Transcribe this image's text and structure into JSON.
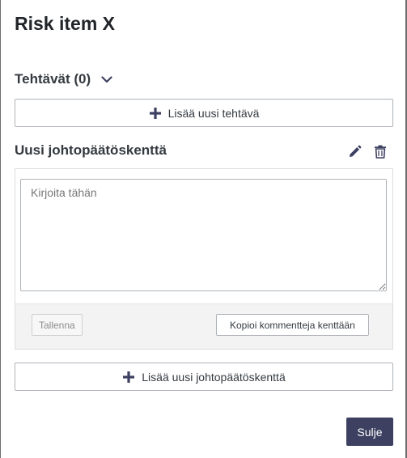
{
  "modal": {
    "title": "Risk item X"
  },
  "tasks": {
    "label": "Tehtävät (0)",
    "add_button_label": "Lisää uusi tehtävä"
  },
  "conclusion": {
    "heading": "Uusi johtopäätöskenttä",
    "placeholder": "Kirjoita tähän",
    "value": "",
    "save_label": "Tallenna",
    "copy_comments_label": "Kopioi kommentteja kenttään"
  },
  "add_conclusion_button_label": "Lisää uusi johtopäätöskenttä",
  "close_label": "Sulje",
  "icons": {
    "tasks_toggle": "chevron-down-icon",
    "add_task": "plus-icon",
    "edit": "pencil-icon",
    "delete": "trash-icon",
    "add_conclusion": "plus-icon"
  },
  "colors": {
    "primary": "#3d4060",
    "text": "#343a40",
    "border": "#aeb3b8",
    "footer_bg": "#f3f3f3"
  }
}
